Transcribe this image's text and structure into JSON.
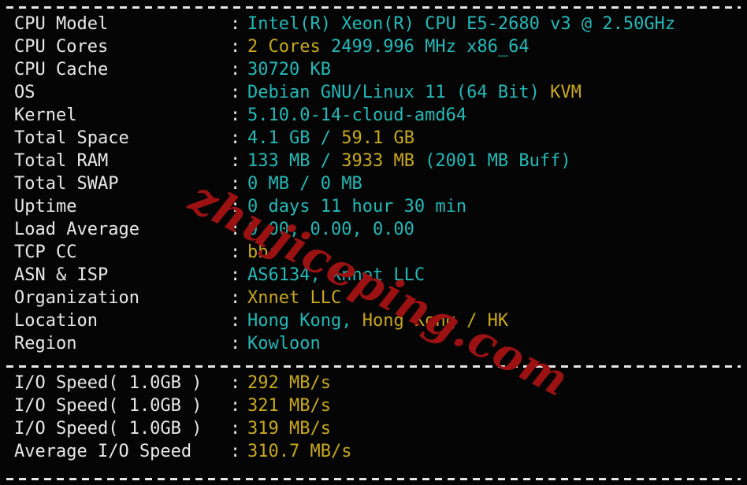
{
  "terminal": {
    "background_color": "#050505",
    "label_color": "#e8e8e8",
    "cyan_color": "#24b8b8",
    "gold_color": "#c9a81e",
    "separator_char": "-",
    "colon": ":"
  },
  "watermark": {
    "text": "zhujiceping.com",
    "color": "#9c1212"
  },
  "system_info": {
    "rows": [
      {
        "label": "CPU Model",
        "value_plain": "Intel(R) Xeon(R) CPU E5-2680 v3 @ 2.50GHz",
        "segments": [
          {
            "text": "Intel(R) Xeon(R) CPU E5-2680 v3 @ 2.50GHz",
            "color": "cyan"
          }
        ]
      },
      {
        "label": "CPU Cores",
        "value_plain": "2 Cores 2499.996 MHz x86_64",
        "segments": [
          {
            "text": "2 Cores ",
            "color": "gold"
          },
          {
            "text": "2499.996 MHz x86_64",
            "color": "cyan"
          }
        ]
      },
      {
        "label": "CPU Cache",
        "value_plain": "30720 KB",
        "segments": [
          {
            "text": "30720 KB",
            "color": "cyan"
          }
        ]
      },
      {
        "label": "OS",
        "value_plain": "Debian GNU/Linux 11 (64 Bit) KVM",
        "segments": [
          {
            "text": "Debian GNU/Linux 11 (64 Bit) ",
            "color": "cyan"
          },
          {
            "text": "KVM",
            "color": "gold"
          }
        ]
      },
      {
        "label": "Kernel",
        "value_plain": "5.10.0-14-cloud-amd64",
        "segments": [
          {
            "text": "5.10.0-14-cloud-amd64",
            "color": "cyan"
          }
        ]
      },
      {
        "label": "Total Space",
        "value_plain": "4.1 GB / 59.1 GB",
        "segments": [
          {
            "text": "4.1 GB / ",
            "color": "cyan"
          },
          {
            "text": "59.1 GB",
            "color": "gold"
          }
        ]
      },
      {
        "label": "Total RAM",
        "value_plain": "133 MB / 3933 MB (2001 MB Buff)",
        "segments": [
          {
            "text": "133 MB / ",
            "color": "cyan"
          },
          {
            "text": "3933 MB",
            "color": "gold"
          },
          {
            "text": " (2001 MB Buff)",
            "color": "cyan"
          }
        ]
      },
      {
        "label": "Total SWAP",
        "value_plain": "0 MB / 0 MB",
        "segments": [
          {
            "text": "0 MB / 0 MB",
            "color": "cyan"
          }
        ]
      },
      {
        "label": "Uptime",
        "value_plain": "0 days 11 hour 30 min",
        "segments": [
          {
            "text": "0 days 11 hour 30 min",
            "color": "cyan"
          }
        ]
      },
      {
        "label": "Load Average",
        "value_plain": "0.00, 0.00, 0.00",
        "segments": [
          {
            "text": "0.00, 0.00, 0.00",
            "color": "cyan"
          }
        ]
      },
      {
        "label": "TCP CC",
        "value_plain": "bbr",
        "segments": [
          {
            "text": "bbr",
            "color": "gold"
          }
        ]
      },
      {
        "label": "ASN & ISP",
        "value_plain": "AS6134, Xnnet LLC",
        "segments": [
          {
            "text": "AS6134, Xnnet LLC",
            "color": "cyan"
          }
        ]
      },
      {
        "label": "Organization",
        "value_plain": "Xnnet LLC",
        "segments": [
          {
            "text": "Xnnet LLC",
            "color": "gold"
          }
        ]
      },
      {
        "label": "Location",
        "value_plain": "Hong Kong, Hong Kong / HK",
        "segments": [
          {
            "text": "Hong Kong, ",
            "color": "cyan"
          },
          {
            "text": "Hong Kong / HK",
            "color": "gold"
          }
        ]
      },
      {
        "label": "Region",
        "value_plain": "Kowloon",
        "segments": [
          {
            "text": "Kowloon",
            "color": "cyan"
          }
        ]
      }
    ]
  },
  "io_benchmark": {
    "rows": [
      {
        "label": "I/O Speed( 1.0GB )",
        "value_plain": "292 MB/s",
        "segments": [
          {
            "text": "292 MB/s",
            "color": "gold"
          }
        ]
      },
      {
        "label": "I/O Speed( 1.0GB )",
        "value_plain": "321 MB/s",
        "segments": [
          {
            "text": "321 MB/s",
            "color": "gold"
          }
        ]
      },
      {
        "label": "I/O Speed( 1.0GB )",
        "value_plain": "319 MB/s",
        "segments": [
          {
            "text": "319 MB/s",
            "color": "gold"
          }
        ]
      },
      {
        "label": "Average I/O Speed",
        "value_plain": "310.7 MB/s",
        "segments": [
          {
            "text": "310.7 MB/s",
            "color": "gold"
          }
        ]
      }
    ]
  }
}
